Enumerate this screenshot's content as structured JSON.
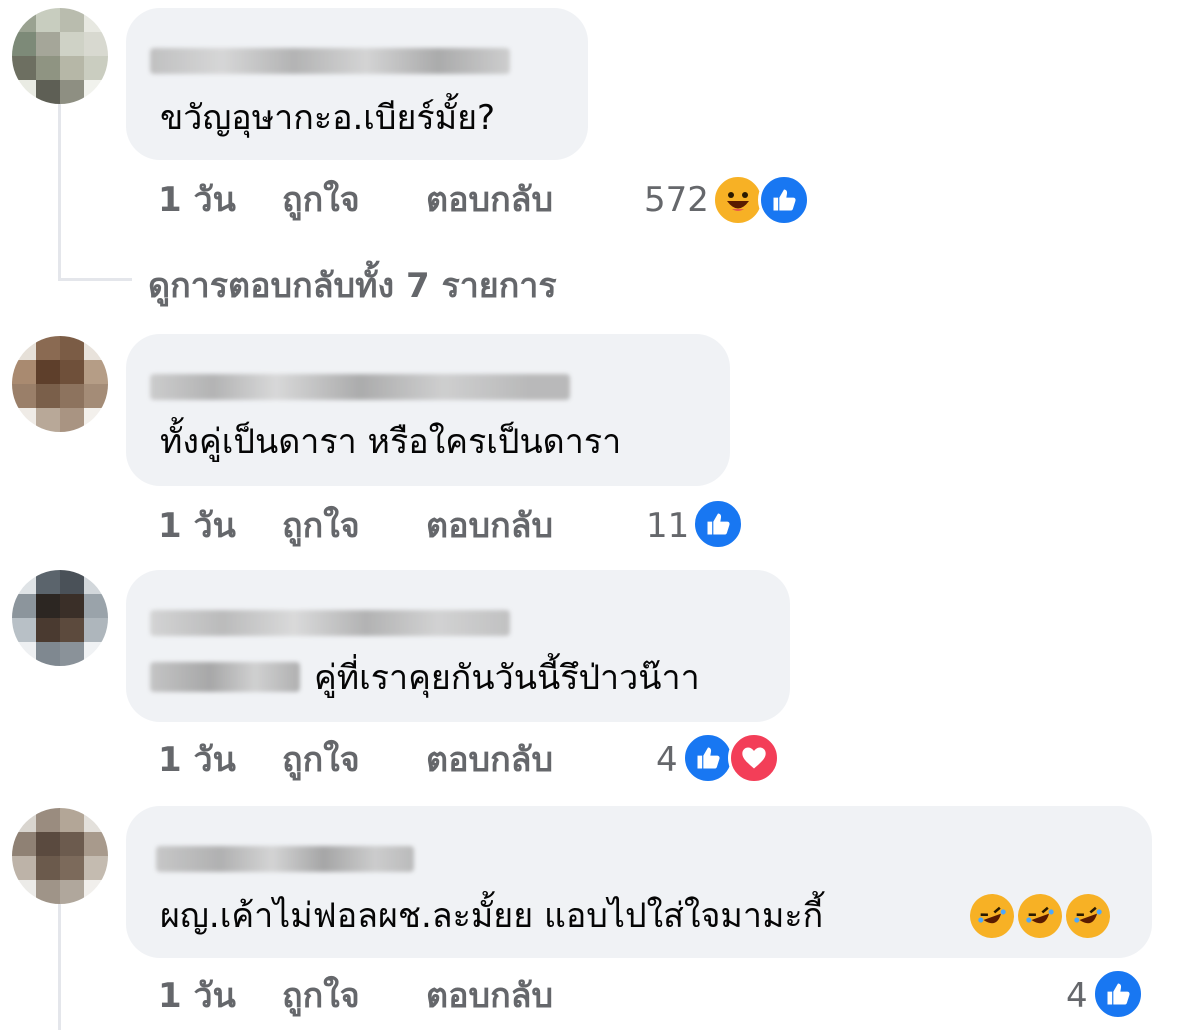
{
  "colors": {
    "like": "#1877f2",
    "love": "#f33e58",
    "haha": "#f7b125",
    "muted": "#65676b",
    "bubble": "#f0f2f5"
  },
  "comments": [
    {
      "text": "ขวัญอุษากะอ.เบียร์มั้ย?",
      "time": "1 วัน",
      "like": "ถูกใจ",
      "reply": "ตอบกลับ",
      "reaction_count": "572",
      "reactions": [
        "haha-icon",
        "like-icon"
      ]
    },
    {
      "text": "ทั้งคู่เป็นดารา หรือใครเป็นดารา",
      "time": "1 วัน",
      "like": "ถูกใจ",
      "reply": "ตอบกลับ",
      "reaction_count": "11",
      "reactions": [
        "like-icon"
      ]
    },
    {
      "text": "คู่ที่เราคุยกันวันนี้รึป่าวน๊าา",
      "time": "1 วัน",
      "like": "ถูกใจ",
      "reply": "ตอบกลับ",
      "reaction_count": "4",
      "reactions": [
        "like-icon",
        "love-icon"
      ]
    },
    {
      "text": "ผญ.เค้าไม่ฟอลผช.ละมั้ยย แอบไปใส่ใจมามะกี้ ",
      "emojis": [
        "rolling-laughing-emoji",
        "rolling-laughing-emoji",
        "rolling-laughing-emoji"
      ],
      "time": "1 วัน",
      "like": "ถูกใจ",
      "reply": "ตอบกลับ",
      "reaction_count": "4",
      "reactions": [
        "like-icon"
      ]
    }
  ],
  "view_replies": "ดูการตอบกลับทั้ง 7 รายการ"
}
